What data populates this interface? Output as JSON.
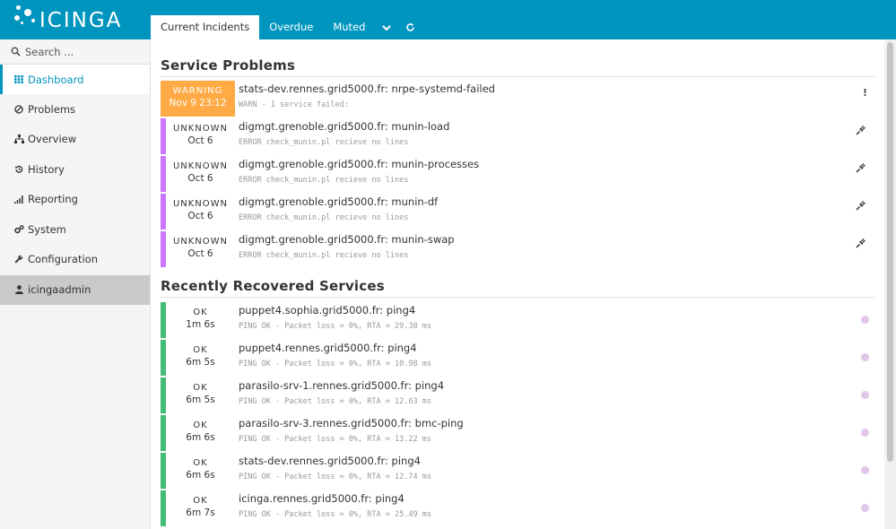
{
  "app": {
    "logo_text": "icinga"
  },
  "tabs": [
    {
      "label": "Current Incidents",
      "active": true
    },
    {
      "label": "Overdue",
      "active": false
    },
    {
      "label": "Muted",
      "active": false
    }
  ],
  "tab_icons": {
    "dropdown": "chevron-down-icon",
    "refresh": "refresh-icon"
  },
  "sidebar": {
    "search_placeholder": "Search ...",
    "items": [
      {
        "label": "Dashboard",
        "icon": "dashboard-icon",
        "active": true
      },
      {
        "label": "Problems",
        "icon": "problems-icon"
      },
      {
        "label": "Overview",
        "icon": "overview-icon"
      },
      {
        "label": "History",
        "icon": "history-icon"
      },
      {
        "label": "Reporting",
        "icon": "reporting-icon"
      },
      {
        "label": "System",
        "icon": "system-icon"
      },
      {
        "label": "Configuration",
        "icon": "wrench-icon"
      }
    ],
    "user": {
      "label": "icingaadmin",
      "icon": "user-icon"
    }
  },
  "service_problems": {
    "title": "Service Problems",
    "rows": [
      {
        "state": "WARNING",
        "time": "Nov 9 23:12",
        "service": "stats-dev.rennes.grid5000.fr: nrpe-systemd-failed",
        "output": "WARN - 1 service failed:",
        "icon": "!"
      },
      {
        "state": "UNKNOWN",
        "time": "Oct 6",
        "service": "digmgt.grenoble.grid5000.fr: munin-load",
        "output": "ERROR check_munin.pl recieve no lines",
        "icon": "plug-icon"
      },
      {
        "state": "UNKNOWN",
        "time": "Oct 6",
        "service": "digmgt.grenoble.grid5000.fr: munin-processes",
        "output": "ERROR check_munin.pl recieve no lines",
        "icon": "plug-icon"
      },
      {
        "state": "UNKNOWN",
        "time": "Oct 6",
        "service": "digmgt.grenoble.grid5000.fr: munin-df",
        "output": "ERROR check_munin.pl recieve no lines",
        "icon": "plug-icon"
      },
      {
        "state": "UNKNOWN",
        "time": "Oct 6",
        "service": "digmgt.grenoble.grid5000.fr: munin-swap",
        "output": "ERROR check_munin.pl recieve no lines",
        "icon": "plug-icon"
      }
    ]
  },
  "recovered": {
    "title": "Recently Recovered Services",
    "rows": [
      {
        "state": "OK",
        "time": "1m 6s",
        "service": "puppet4.sophia.grid5000.fr: ping4",
        "output": "PING OK - Packet loss = 0%, RTA = 29.38 ms"
      },
      {
        "state": "OK",
        "time": "6m 5s",
        "service": "puppet4.rennes.grid5000.fr: ping4",
        "output": "PING OK - Packet loss = 0%, RTA = 10.98 ms"
      },
      {
        "state": "OK",
        "time": "6m 5s",
        "service": "parasilo-srv-1.rennes.grid5000.fr: ping4",
        "output": "PING OK - Packet loss = 0%, RTA = 12.63 ms"
      },
      {
        "state": "OK",
        "time": "6m 6s",
        "service": "parasilo-srv-3.rennes.grid5000.fr: bmc-ping",
        "output": "PING OK - Packet loss = 0%, RTA = 13.22 ms"
      },
      {
        "state": "OK",
        "time": "6m 6s",
        "service": "stats-dev.rennes.grid5000.fr: ping4",
        "output": "PING OK - Packet loss = 0%, RTA = 12.74 ms"
      },
      {
        "state": "OK",
        "time": "6m 7s",
        "service": "icinga.rennes.grid5000.fr: ping4",
        "output": "PING OK - Packet loss = 0%, RTA = 25.49 ms"
      }
    ]
  },
  "colors": {
    "brand": "#0095bf",
    "warning": "#ffaa44",
    "unknown": "#cc77ff",
    "ok": "#44bb77"
  }
}
